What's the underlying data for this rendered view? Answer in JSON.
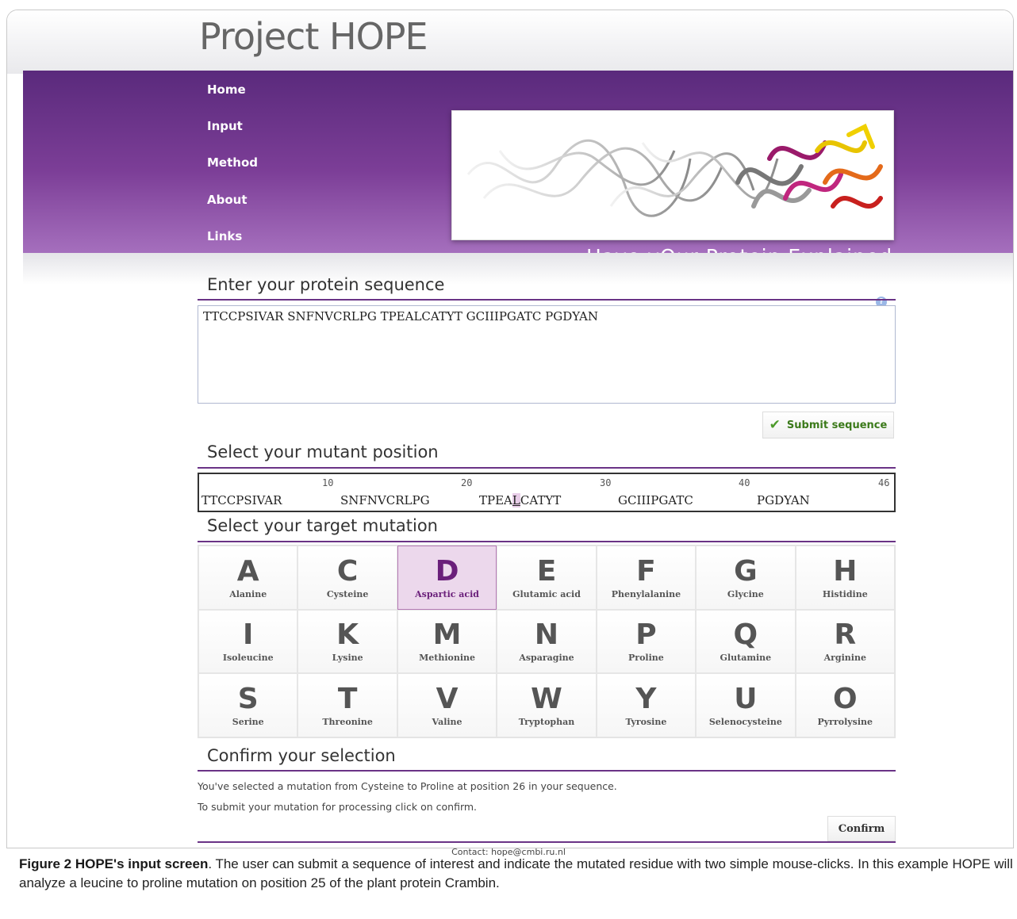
{
  "site_title": "Project HOPE",
  "nav": [
    "Home",
    "Input",
    "Method",
    "About",
    "Links"
  ],
  "tagline": "Have yOur Protein Explained",
  "help_icon_glyph": "?",
  "sequence_section": {
    "title": "Enter your protein sequence",
    "value": "TTCCPSIVAR SNFNVCRLPG TPEALCATYT GCIIIPGATC PGDYAN",
    "submit_label": "Submit sequence"
  },
  "position_section": {
    "title": "Select your mutant position",
    "ticks": [
      "10",
      "20",
      "30",
      "40",
      "46"
    ],
    "chunks": [
      "TTCCPSIVAR",
      "SNFNVCRLPG",
      "GCIIIPGATC",
      "PGDYAN"
    ],
    "chunk3_pre": "TPEA",
    "chunk3_sel": "L",
    "chunk3_post": "CATYT"
  },
  "mutation_section": {
    "title": "Select your target mutation",
    "amino_acids": [
      {
        "letter": "A",
        "name": "Alanine"
      },
      {
        "letter": "C",
        "name": "Cysteine"
      },
      {
        "letter": "D",
        "name": "Aspartic acid",
        "selected": true
      },
      {
        "letter": "E",
        "name": "Glutamic acid"
      },
      {
        "letter": "F",
        "name": "Phenylalanine"
      },
      {
        "letter": "G",
        "name": "Glycine"
      },
      {
        "letter": "H",
        "name": "Histidine"
      },
      {
        "letter": "I",
        "name": "Isoleucine"
      },
      {
        "letter": "K",
        "name": "Lysine"
      },
      {
        "letter": "M",
        "name": "Methionine"
      },
      {
        "letter": "N",
        "name": "Asparagine"
      },
      {
        "letter": "P",
        "name": "Proline"
      },
      {
        "letter": "Q",
        "name": "Glutamine"
      },
      {
        "letter": "R",
        "name": "Arginine"
      },
      {
        "letter": "S",
        "name": "Serine"
      },
      {
        "letter": "T",
        "name": "Threonine"
      },
      {
        "letter": "V",
        "name": "Valine"
      },
      {
        "letter": "W",
        "name": "Tryptophan"
      },
      {
        "letter": "Y",
        "name": "Tyrosine"
      },
      {
        "letter": "U",
        "name": "Selenocysteine"
      },
      {
        "letter": "O",
        "name": "Pyrrolysine"
      }
    ]
  },
  "confirm_section": {
    "title": "Confirm your selection",
    "line1": "You've selected a mutation from Cysteine to Proline at position 26 in your sequence.",
    "line2": "To submit your mutation for processing click on confirm.",
    "confirm_label": "Confirm"
  },
  "contact": "Contact: hope@cmbi.ru.nl",
  "caption": {
    "bold": "Figure 2 HOPE's input screen",
    "text": ". The user can submit a sequence of interest and indicate the mutated residue with two simple mouse-clicks. In this example HOPE will analyze a leucine to proline mutation on position 25 of the plant protein Crambin."
  },
  "colors": {
    "banner_purple": "#6b3289",
    "rule_purple": "#6a3386",
    "selected_bg": "#ecd8ec",
    "submit_green": "#3b7a1a"
  }
}
